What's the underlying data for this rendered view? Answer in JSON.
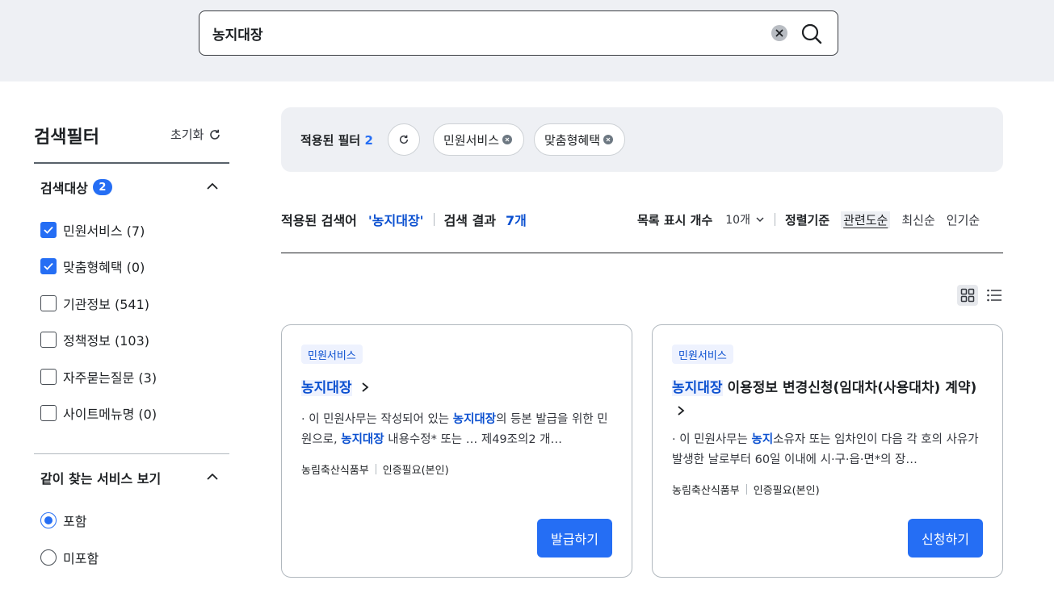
{
  "search": {
    "value": "농지대장",
    "clear_icon": "close-circle-icon",
    "search_icon": "search-icon"
  },
  "sidebar": {
    "title": "검색필터",
    "reset_label": "초기화",
    "target_section": {
      "title": "검색대상",
      "badge": "2",
      "options": [
        {
          "label": "민원서비스 (7)",
          "checked": true
        },
        {
          "label": "맞춤형혜택 (0)",
          "checked": true
        },
        {
          "label": "기관정보 (541)",
          "checked": false
        },
        {
          "label": "정책정보 (103)",
          "checked": false
        },
        {
          "label": "자주묻는질문 (3)",
          "checked": false
        },
        {
          "label": "사이트메뉴명 (0)",
          "checked": false
        }
      ]
    },
    "related_section": {
      "title": "같이 찾는 서비스 보기",
      "options": [
        {
          "label": "포함",
          "selected": true
        },
        {
          "label": "미포함",
          "selected": false
        }
      ]
    }
  },
  "applied_filters": {
    "label": "적용된 필터",
    "count": "2",
    "chips": [
      "민원서비스",
      "맞춤형혜택"
    ]
  },
  "results": {
    "applied_keyword_label": "적용된 검색어",
    "keyword": "'농지대장'",
    "result_label": "검색 결과",
    "count": "7개",
    "page_size_label": "목록 표시 개수",
    "page_size_value": "10개",
    "sort_label": "정렬기준",
    "sort_options": [
      "관련도순",
      "최신순",
      "인기순"
    ],
    "sort_active": "관련도순"
  },
  "cards": [
    {
      "tag": "민원서비스",
      "title_highlight": "농지대장",
      "title_rest": "",
      "desc_parts": [
        {
          "t": "· 이 민원사무는 작성되어 있는 ",
          "hl": false
        },
        {
          "t": "농지대장",
          "hl": true
        },
        {
          "t": "의 등본 발급을 위한 민원으로, ",
          "hl": false
        },
        {
          "t": "농지대장",
          "hl": true
        },
        {
          "t": " 내용수정* 또는 … 제49조의2 개…",
          "hl": false
        }
      ],
      "org": "농림축산식품부",
      "auth": "인증필요(본인)",
      "button": "발급하기"
    },
    {
      "tag": "민원서비스",
      "title_highlight": "농지대장",
      "title_rest": " 이용정보 변경신청(임대차(사용대차) 계약)",
      "desc_parts": [
        {
          "t": "· 이 민원사무는 ",
          "hl": false
        },
        {
          "t": "농지",
          "hl": true
        },
        {
          "t": "소유자 또는 임차인이 다음 각 호의 사유가 발생한 날로부터 60일 이내에 시·구·읍·면*의 장…",
          "hl": false
        }
      ],
      "org": "농림축산식품부",
      "auth": "인증필요(본인)",
      "button": "신청하기"
    }
  ],
  "colors": {
    "accent": "#256ef4",
    "highlight_text": "#0b50d0",
    "band_bg": "#eef0f4"
  }
}
